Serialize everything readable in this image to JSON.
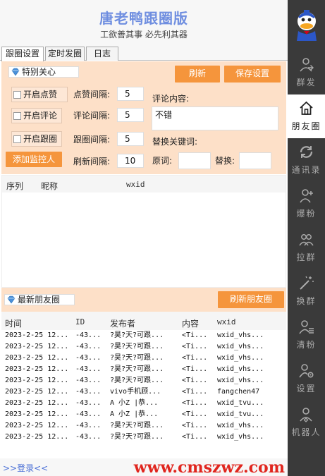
{
  "header": {
    "title": "唐老鸭跟圈版",
    "subtitle": "工欲善其事 必先利其器"
  },
  "tabs": [
    "跟圈设置",
    "定时发圈",
    "日志"
  ],
  "special": {
    "title": "特别关心",
    "refresh": "刷新",
    "save": "保存设置",
    "like_toggle": "开启点赞",
    "comment_toggle": "开启评论",
    "follow_toggle": "开启跟圈",
    "add_monitor": "添加监控人",
    "like_interval_label": "点赞间隔:",
    "like_interval": "5",
    "comment_interval_label": "评论间隔:",
    "comment_interval": "5",
    "follow_interval_label": "跟圈间隔:",
    "follow_interval": "5",
    "refresh_interval_label": "刷新间隔:",
    "refresh_interval": "10",
    "comment_content_label": "评论内容:",
    "comment_content": "不错",
    "replace_keywords_label": "替换关键词:",
    "original_label": "原词:",
    "original_value": "",
    "replace_label": "替换:",
    "replace_value": ""
  },
  "monitor": {
    "columns": [
      "序列",
      "昵称",
      "wxid"
    ]
  },
  "moments": {
    "title": "最新朋友圈",
    "refresh": "刷新朋友圈",
    "columns": [
      "时间",
      "ID",
      "发布者",
      "内容",
      "wxid"
    ],
    "rows": [
      [
        "2023-2-25 12...",
        "-43...",
        "?昊?天?可跟...",
        "<Ti...",
        "wxid_vhs..."
      ],
      [
        "2023-2-25 12...",
        "-43...",
        "?昊?天?可跟...",
        "<Ti...",
        "wxid_vhs..."
      ],
      [
        "2023-2-25 12...",
        "-43...",
        "?昊?天?可跟...",
        "<Ti...",
        "wxid_vhs..."
      ],
      [
        "2023-2-25 12...",
        "-43...",
        "?昊?天?可跟...",
        "<Ti...",
        "wxid_vhs..."
      ],
      [
        "2023-2-25 12...",
        "-43...",
        "?昊?天?可跟...",
        "<Ti...",
        "wxid_vhs..."
      ],
      [
        "2023-2-25 12...",
        "-43...",
        "vivo手机顾...",
        "<Ti...",
        "fangchen47"
      ],
      [
        "2023-2-25 12...",
        "-43...",
        "A 小Z  |恭...",
        "<Ti...",
        "wxid_tvu..."
      ],
      [
        "2023-2-25 12...",
        "-43...",
        "A 小Z  |恭...",
        "<Ti...",
        "wxid_tvu..."
      ],
      [
        "2023-2-25 12...",
        "-43...",
        "?昊?天?可跟...",
        "<Ti...",
        "wxid_vhs..."
      ],
      [
        "2023-2-25 12...",
        "-43...",
        "?昊?天?可跟...",
        "<Ti...",
        "wxid_vhs..."
      ]
    ]
  },
  "footer": {
    "login": ">>登录<<",
    "watermark": "www.cmszwz.com"
  },
  "sidebar": {
    "items": [
      {
        "label": "群发",
        "icon": "group-send-icon"
      },
      {
        "label": "朋友圈",
        "icon": "home-icon"
      },
      {
        "label": "通讯录",
        "icon": "sync-icon"
      },
      {
        "label": "爆粉",
        "icon": "add-user-icon"
      },
      {
        "label": "拉群",
        "icon": "group-icon"
      },
      {
        "label": "换群",
        "icon": "magic-icon"
      },
      {
        "label": "清粉",
        "icon": "user-list-icon"
      },
      {
        "label": "设置",
        "icon": "user-settings-icon"
      },
      {
        "label": "机器人",
        "icon": "robot-user-icon"
      }
    ],
    "active_index": 1,
    "colors": {
      "background": "#3a3a3a",
      "active": "#ffffff",
      "accent": "#f5953c"
    }
  }
}
